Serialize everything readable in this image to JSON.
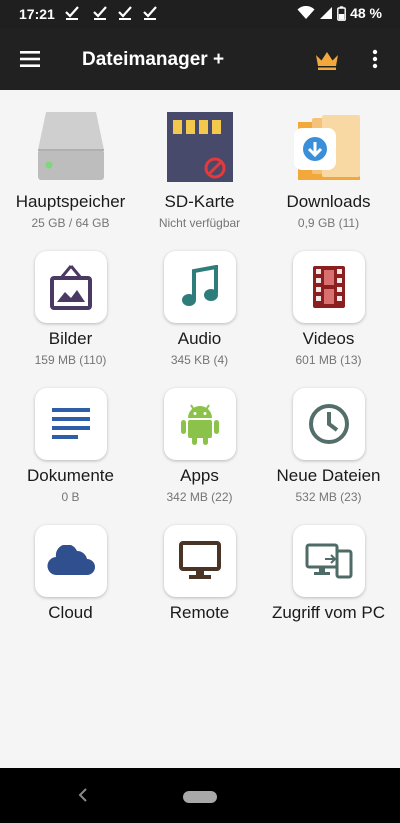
{
  "status_bar": {
    "time": "17:21",
    "battery": "48 %",
    "notification_icons": [
      "check-icon",
      "check-icon",
      "check-icon",
      "check-icon"
    ],
    "system_icons": [
      "wifi-icon",
      "cellular-signal-icon",
      "battery-icon"
    ]
  },
  "app_bar": {
    "title": "Dateimanager +",
    "menu_icon": "hamburger-menu-icon",
    "premium_icon": "crown-icon",
    "more_icon": "more-vert-icon",
    "accent_color": "#f2a83b",
    "background_color": "#212121"
  },
  "grid": [
    {
      "label": "Hauptspeicher",
      "sub": "25 GB / 64 GB",
      "icon": "hard-drive-icon"
    },
    {
      "label": "SD-Karte",
      "sub": "Nicht verfügbar",
      "icon": "sd-card-icon"
    },
    {
      "label": "Downloads",
      "sub": "0,9 GB (11)",
      "icon": "downloads-folder-icon"
    },
    {
      "label": "Bilder",
      "sub": "159 MB (110)",
      "icon": "picture-frame-icon"
    },
    {
      "label": "Audio",
      "sub": "345 KB (4)",
      "icon": "music-note-icon"
    },
    {
      "label": "Videos",
      "sub": "601 MB (13)",
      "icon": "film-strip-icon"
    },
    {
      "label": "Dokumente",
      "sub": "0 B",
      "icon": "document-lines-icon"
    },
    {
      "label": "Apps",
      "sub": "342 MB (22)",
      "icon": "android-icon"
    },
    {
      "label": "Neue Dateien",
      "sub": "532 MB (23)",
      "icon": "clock-icon"
    },
    {
      "label": "Cloud",
      "sub": "",
      "icon": "cloud-icon"
    },
    {
      "label": "Remote",
      "sub": "",
      "icon": "monitor-icon"
    },
    {
      "label": "Zugriff vom PC",
      "sub": "",
      "icon": "pc-phone-icon"
    }
  ],
  "nav_bar": {
    "back_icon": "back-chevron-icon",
    "home_icon": "home-pill-icon"
  }
}
